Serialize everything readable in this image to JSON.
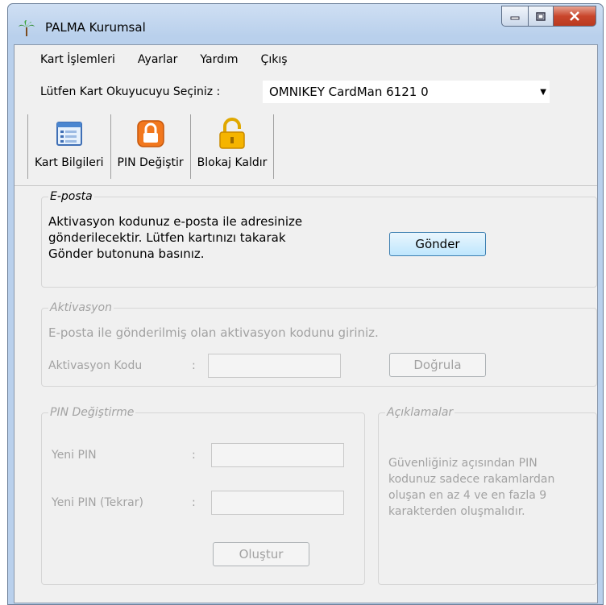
{
  "window": {
    "title": "PALMA Kurumsal"
  },
  "menu": [
    "Kart İşlemleri",
    "Ayarlar",
    "Yardım",
    "Çıkış"
  ],
  "reader": {
    "label": "Lütfen Kart Okuyucuyu Seçiniz :",
    "selected": "OMNIKEY CardMan 6121 0"
  },
  "toolbar": [
    {
      "label": "Kart Bilgileri",
      "icon": "card-info-icon"
    },
    {
      "label": "PIN Değiştir",
      "icon": "lock-orange-icon"
    },
    {
      "label": "Blokaj Kaldır",
      "icon": "unlock-icon"
    }
  ],
  "eposta": {
    "legend": "E-posta",
    "message_lines": [
      "Aktivasyon kodunuz e-posta ile adresinize",
      "gönderilecektir. Lütfen kartınızı takarak",
      "Gönder butonuna basınız."
    ],
    "send_label": "Gönder"
  },
  "aktivasyon": {
    "legend": "Aktivasyon",
    "message": "E-posta ile gönderilmiş olan aktivasyon kodunu giriniz.",
    "code_label": "Aktivasyon Kodu",
    "colon": ":",
    "verify_label": "Doğrula"
  },
  "pin": {
    "legend": "PIN Değiştirme",
    "new_label": "Yeni PIN",
    "repeat_label": "Yeni PIN (Tekrar)",
    "colon": ":",
    "create_label": "Oluştur"
  },
  "aciklama": {
    "legend": "Açıklamalar",
    "lines": [
      "Güvenliğiniz açısından PIN",
      "kodunuz sadece rakamlardan",
      "oluşan en az 4 ve en fazla 9",
      "karakterden oluşmalıdır."
    ]
  },
  "colors": {
    "accent": "#3c7fb1",
    "disabled_text": "#a2a2a2",
    "close_red": "#c9462c"
  }
}
